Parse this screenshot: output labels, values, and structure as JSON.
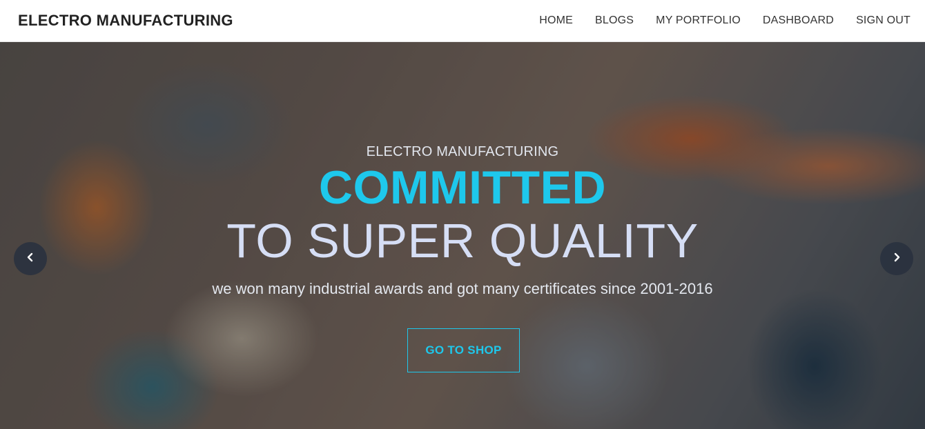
{
  "navbar": {
    "brand": "ELECTRO MANUFACTURING",
    "links": [
      "HOME",
      "BLOGS",
      "MY PORTFOLIO",
      "DASHBOARD",
      "SIGN OUT"
    ]
  },
  "hero": {
    "eyebrow": "ELECTRO MANUFACTURING",
    "title": "COMMITTED",
    "subtitle": "TO SUPER QUALITY",
    "description": "we won many industrial awards and got many certificates since 2001-2016",
    "cta_label": "GO TO SHOP",
    "prev_icon": "chevron-left-icon",
    "next_icon": "chevron-right-icon"
  },
  "colors": {
    "accent": "#1ec8ec",
    "subtitle": "#d6def5",
    "navbar_bg": "#ffffff",
    "arrow_bg": "#28303e"
  }
}
